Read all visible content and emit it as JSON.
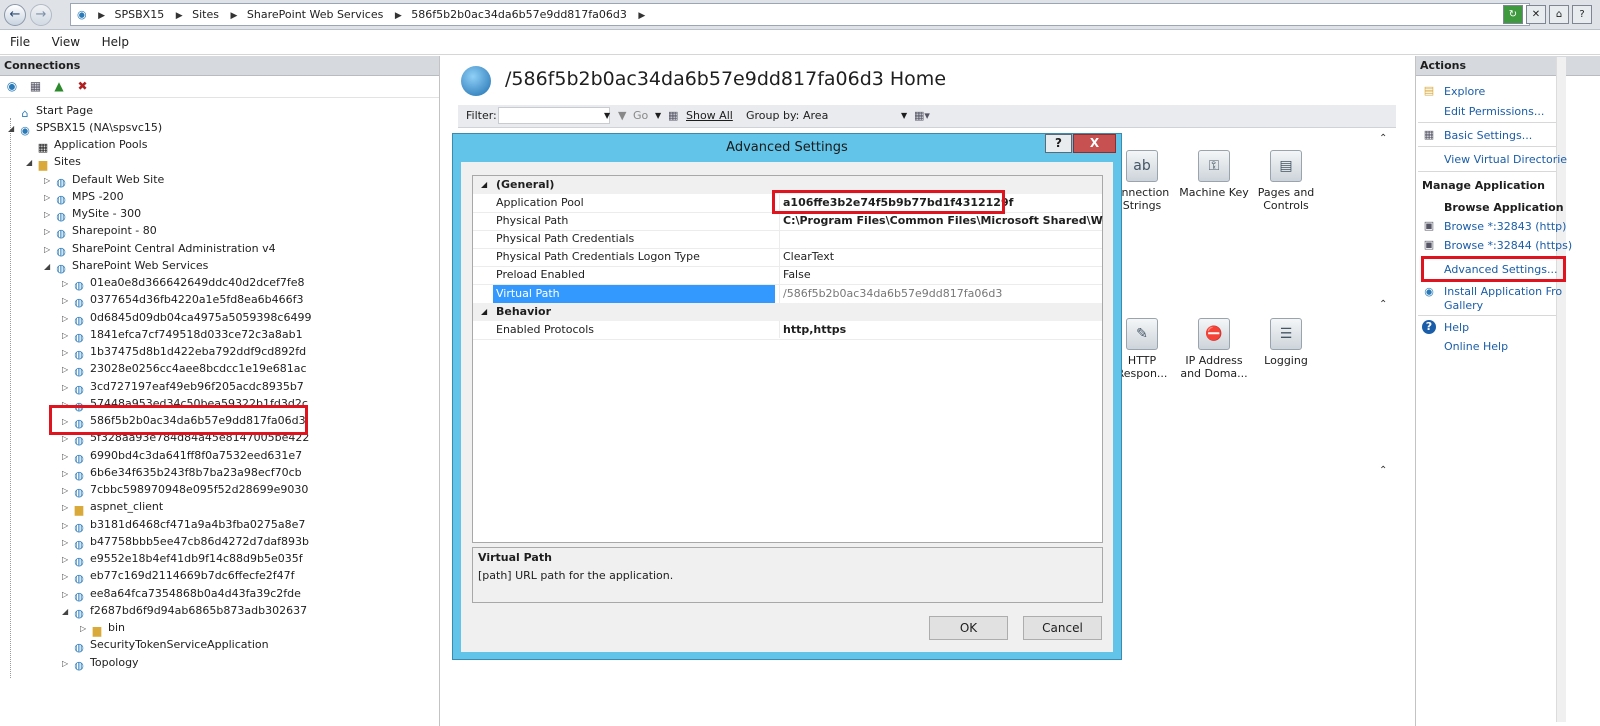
{
  "address": {
    "crumbs": [
      "SPSBX15",
      "Sites",
      "SharePoint Web Services",
      "586f5b2b0ac34da6b57e9dd817fa06d3"
    ]
  },
  "menu": [
    "File",
    "View",
    "Help"
  ],
  "connections": {
    "title": "Connections",
    "tree": [
      {
        "label": "Start Page"
      },
      {
        "label": "SPSBX15 (NA\\spsvc15)"
      },
      {
        "label": "Application Pools"
      },
      {
        "label": "Sites"
      },
      {
        "label": "Default Web Site"
      },
      {
        "label": "MPS -200"
      },
      {
        "label": "MySite - 300"
      },
      {
        "label": "Sharepoint - 80"
      },
      {
        "label": "SharePoint Central Administration v4"
      },
      {
        "label": "SharePoint Web Services"
      },
      {
        "label": "01ea0e8d366642649ddc40d2dcef7fe8"
      },
      {
        "label": "0377654d36fb4220a1e5fd8ea6b466f3"
      },
      {
        "label": "0d6845d09db04ca4975a5059398c6499"
      },
      {
        "label": "1841efca7cf749518d033ce72c3a8ab1"
      },
      {
        "label": "1b37475d8b1d422eba792ddf9cd892fd"
      },
      {
        "label": "23028e0256cc4aee8bcdcc1e19e681ac"
      },
      {
        "label": "3cd727197eaf49eb96f205acdc8935b7"
      },
      {
        "label": "57448a953ed34c50bea59322b1fd3d2c"
      },
      {
        "label": "586f5b2b0ac34da6b57e9dd817fa06d3"
      },
      {
        "label": "5f328aa93e784d84a45e8147005be422"
      },
      {
        "label": "6990bd4c3da641ff8f0a7532eed631e7"
      },
      {
        "label": "6b6e34f635b243f8b7ba23a98ecf70cb"
      },
      {
        "label": "7cbbc598970948e095f52d28699e9030"
      },
      {
        "label": "aspnet_client"
      },
      {
        "label": "b3181d6468cf471a9a4b3fba0275a8e7"
      },
      {
        "label": "b47758bbb5ee47cb86d4272d7daf893b"
      },
      {
        "label": "e9552e18b4ef41db9f14c88d9b5e035f"
      },
      {
        "label": "eb77c169d2114669b7dc6ffecfe2f47f"
      },
      {
        "label": "ee8a64fca7354868b0a4d43fa39c2fde"
      },
      {
        "label": "f2687bd6f9d94ab6865b873adb302637"
      },
      {
        "label": "bin"
      },
      {
        "label": "SecurityTokenServiceApplication"
      },
      {
        "label": "Topology"
      }
    ]
  },
  "center": {
    "title": "/586f5b2b0ac34da6b57e9dd817fa06d3 Home",
    "filter_label": "Filter:",
    "go_label": "Go",
    "show_all_label": "Show All",
    "group_by_label": "Group by:",
    "group_by_value": "Area",
    "features": [
      {
        "label": "onnection Strings",
        "icon": "connection-strings-icon"
      },
      {
        "label": "Machine Key",
        "icon": "machine-key-icon"
      },
      {
        "label": "Pages and Controls",
        "icon": "pages-controls-icon"
      },
      {
        "label": "HTTP Respon...",
        "icon": "http-response-icon"
      },
      {
        "label": "IP Address and Doma...",
        "icon": "ip-address-icon"
      },
      {
        "label": "Logging",
        "icon": "logging-icon"
      }
    ]
  },
  "actions": {
    "title": "Actions",
    "explore": "Explore",
    "edit_permissions": "Edit Permissions...",
    "basic_settings": "Basic Settings...",
    "view_virtual_directories": "View Virtual Directorie",
    "manage_application": "Manage Application",
    "browse_application": "Browse Application",
    "browse_http": "Browse *:32843 (http)",
    "browse_https": "Browse *:32844 (https)",
    "advanced_settings": "Advanced Settings...",
    "install_gallery_1": "Install Application Fro",
    "install_gallery_2": "Gallery",
    "help": "Help",
    "online_help": "Online Help"
  },
  "dialog": {
    "title": "Advanced Settings",
    "help_btn": "?",
    "close_btn": "X",
    "general_category": "(General)",
    "behavior_category": "Behavior",
    "rows": [
      {
        "key": "Application Pool",
        "value": "a106ffe3b2e74f5b9b77bd1f4312129f"
      },
      {
        "key": "Physical Path",
        "value": "C:\\Program Files\\Common Files\\Microsoft Shared\\Web Serv"
      },
      {
        "key": "Physical Path Credentials",
        "value": ""
      },
      {
        "key": "Physical Path Credentials Logon Type",
        "value": "ClearText"
      },
      {
        "key": "Preload Enabled",
        "value": "False"
      },
      {
        "key": "Virtual Path",
        "value": "/586f5b2b0ac34da6b57e9dd817fa06d3"
      },
      {
        "key": "Enabled Protocols",
        "value": "http,https"
      }
    ],
    "desc_title": "Virtual Path",
    "desc_text": "[path] URL path for the application.",
    "ok": "OK",
    "cancel": "Cancel"
  },
  "colors": {
    "highlight_red": "#e0141e",
    "dialog_frame": "#62c4e8",
    "selection_blue": "#3399ff",
    "link_blue": "#1a5da8"
  }
}
